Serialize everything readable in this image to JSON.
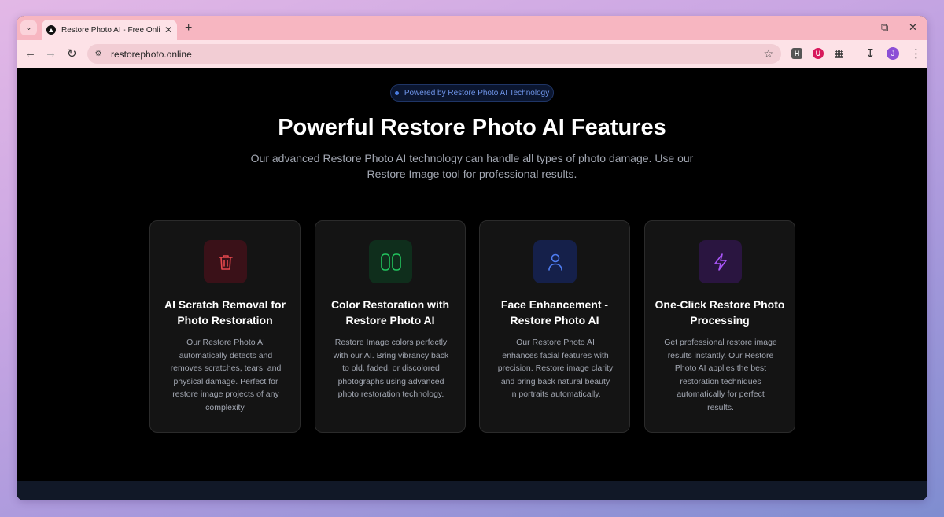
{
  "browser": {
    "tab_title": "Restore Photo AI - Free Online I",
    "new_tab_label": "+",
    "url": "restorephoto.online",
    "profile_initial": "J",
    "extensions": [
      {
        "name": "h-extension-icon",
        "label": "H"
      },
      {
        "name": "shield-extension-icon",
        "label": "U"
      }
    ]
  },
  "hero": {
    "badge": "Powered by Restore Photo AI Technology",
    "title": "Powerful Restore Photo AI Features",
    "subtitle": "Our advanced Restore Photo AI technology can handle all types of photo damage. Use our Restore Image tool for professional results."
  },
  "features": [
    {
      "icon": "trash-icon",
      "color": "#e5484d",
      "title": "AI Scratch Removal for Photo Restoration",
      "description": "Our Restore Photo AI automatically detects and removes scratches, tears, and physical damage. Perfect for restore image projects of any complexity."
    },
    {
      "icon": "columns-icon",
      "color": "#22c55e",
      "title": "Color Restoration with Restore Photo AI",
      "description": "Restore Image colors perfectly with our AI. Bring vibrancy back to old, faded, or discolored photographs using advanced photo restoration technology."
    },
    {
      "icon": "user-icon",
      "color": "#4f7cf0",
      "title": "Face Enhancement - Restore Photo AI",
      "description": "Our Restore Photo AI enhances facial features with precision. Restore image clarity and bring back natural beauty in portraits automatically."
    },
    {
      "icon": "lightning-icon",
      "color": "#a855f7",
      "title": "One-Click Restore Photo Processing",
      "description": "Get professional restore image results instantly. Our Restore Photo AI applies the best restoration techniques automatically for perfect results."
    }
  ]
}
